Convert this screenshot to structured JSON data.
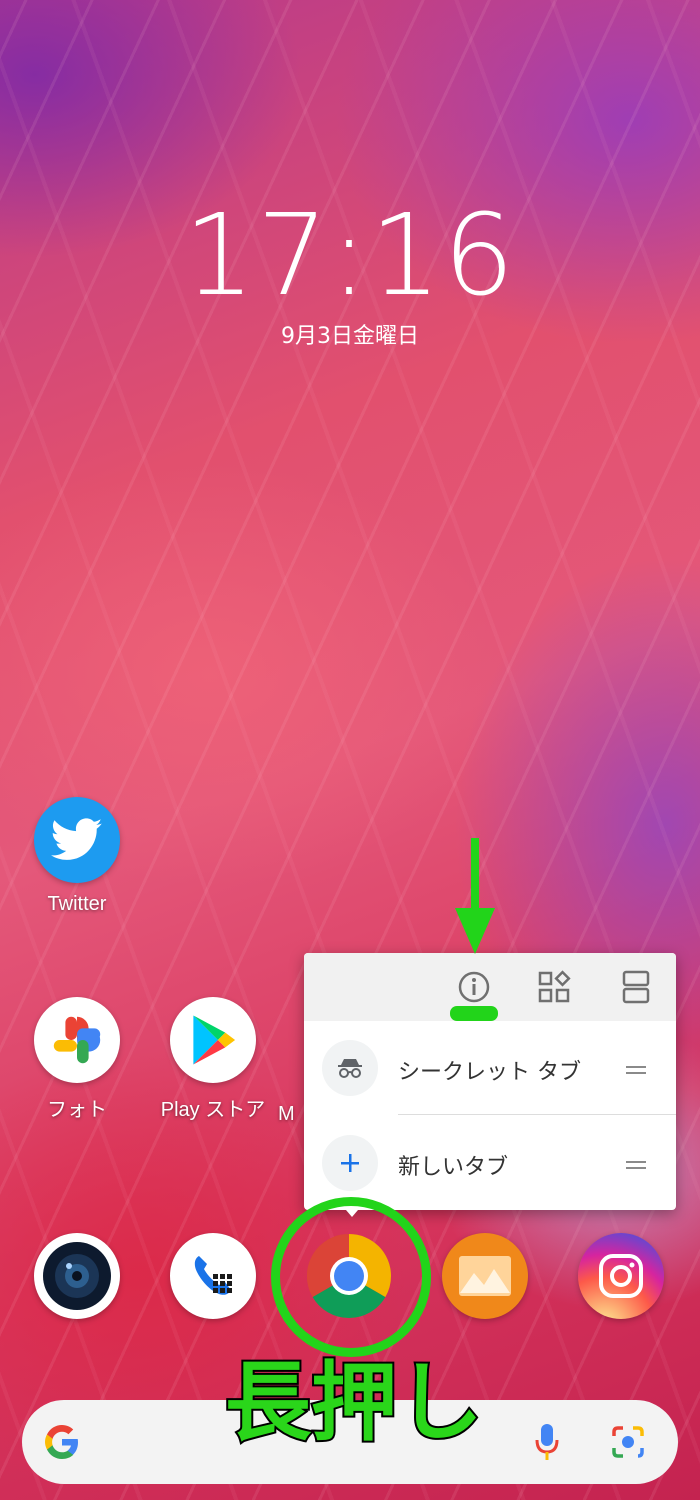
{
  "lockscreen": {
    "time": "17:16",
    "date": "9月3日金曜日"
  },
  "apps": {
    "twitter": "Twitter",
    "photos": "フォト",
    "play_store": "Play ストア",
    "hidden_partial": "M"
  },
  "shortcut_menu": {
    "top_icons": [
      "app-info-icon",
      "widgets-icon",
      "split-screen-icon"
    ],
    "items": [
      {
        "label": "シークレット タブ",
        "icon": "incognito-icon"
      },
      {
        "label": "新しいタブ",
        "icon": "plus-icon"
      }
    ]
  },
  "dock": [
    "camera",
    "phone",
    "chrome",
    "gallery",
    "instagram"
  ],
  "annotation": {
    "label": "長押し",
    "color": "#22d41a"
  },
  "search_bar": {
    "icons": [
      "google-g-icon",
      "mic-icon",
      "lens-icon"
    ]
  }
}
